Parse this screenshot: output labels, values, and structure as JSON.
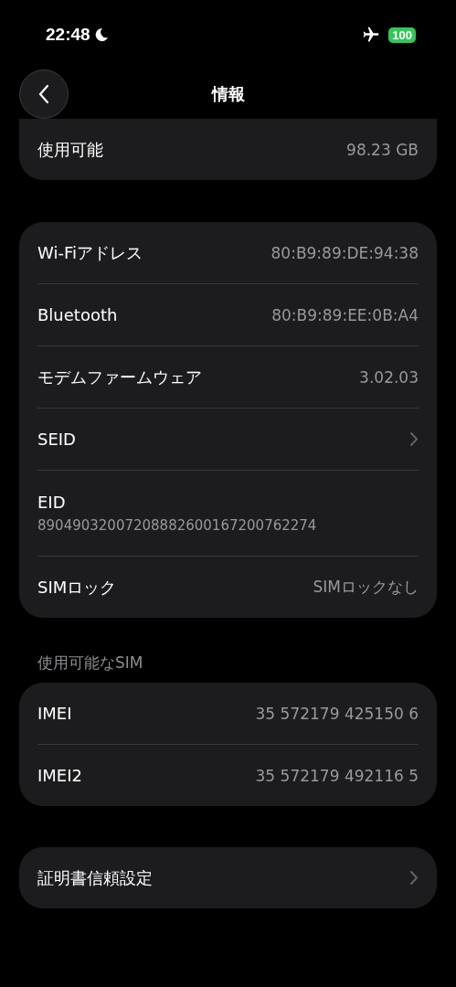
{
  "status_bar": {
    "time": "22:48",
    "battery": "100"
  },
  "nav": {
    "title": "情報"
  },
  "groups": [
    {
      "rows": [
        {
          "kind": "value",
          "label": "使用可能",
          "value": "98.23 GB"
        }
      ]
    },
    {
      "rows": [
        {
          "kind": "value",
          "label": "Wi-Fiアドレス",
          "value": "80:B9:89:DE:94:38"
        },
        {
          "kind": "value",
          "label": "Bluetooth",
          "value": "80:B9:89:EE:0B:A4"
        },
        {
          "kind": "value",
          "label": "モデムファームウェア",
          "value": "3.02.03"
        },
        {
          "kind": "chevron",
          "label": "SEID"
        },
        {
          "kind": "stacked",
          "label": "EID",
          "value": "89049032007208882600167200762274"
        },
        {
          "kind": "value",
          "label": "SIMロック",
          "value": "SIMロックなし"
        }
      ]
    },
    {
      "header": "使用可能なSIM",
      "rows": [
        {
          "kind": "value",
          "label": "IMEI",
          "value": "35 572179 425150 6"
        },
        {
          "kind": "value",
          "label": "IMEI2",
          "value": "35 572179 492116 5"
        }
      ]
    },
    {
      "rows": [
        {
          "kind": "chevron",
          "label": "証明書信頼設定"
        }
      ]
    }
  ]
}
